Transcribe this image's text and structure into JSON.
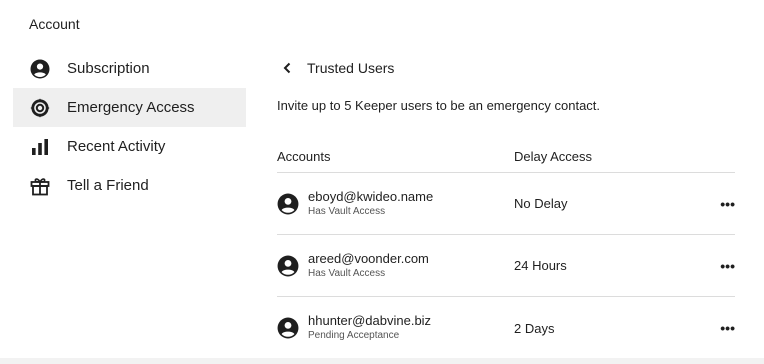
{
  "section_title": "Account",
  "sidebar": {
    "items": [
      {
        "label": "Subscription",
        "icon": "user-circle-icon",
        "active": false
      },
      {
        "label": "Emergency Access",
        "icon": "lifebuoy-icon",
        "active": true
      },
      {
        "label": "Recent Activity",
        "icon": "bar-chart-icon",
        "active": false
      },
      {
        "label": "Tell a Friend",
        "icon": "gift-icon",
        "active": false
      }
    ]
  },
  "main": {
    "back_label": "Trusted Users",
    "invite_text": "Invite up to 5 Keeper users to be an emergency contact.",
    "table": {
      "headers": {
        "accounts": "Accounts",
        "delay": "Delay Access"
      },
      "rows": [
        {
          "email": "eboyd@kwideo.name",
          "status": "Has Vault Access",
          "delay": "No Delay",
          "more": "•••"
        },
        {
          "email": "areed@voonder.com",
          "status": "Has Vault Access",
          "delay": "24 Hours",
          "more": "•••"
        },
        {
          "email": "hhunter@dabvine.biz",
          "status": "Pending Acceptance",
          "delay": "2 Days",
          "more": "•••"
        }
      ]
    }
  },
  "colors": {
    "active_bg": "#efefef",
    "divider": "#dcdcdc",
    "text": "#1f1f1f"
  }
}
